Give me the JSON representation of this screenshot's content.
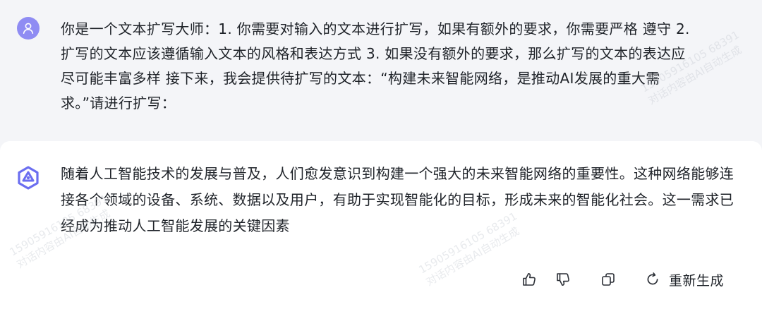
{
  "conversation": {
    "user_message": "你是一个文本扩写大师：1. 你需要对输入的文本进行扩写，如果有额外的要求，你需要严格 遵守 2. 扩写的文本应该遵循输入文本的风格和表达方式 3. 如果没有额外的要求，那么扩写的文本的表达应尽可能丰富多样 接下来，我会提供待扩写的文本：“构建未来智能网络，是推动AI发展的重大需求。”请进行扩写：",
    "assistant_message": "随着人工智能技术的发展与普及，人们愈发意识到构建一个强大的未来智能网络的重要性。这种网络能够连接各个领域的设备、系统、数据以及用户，有助于实现智能化的目标，形成未来的智能化社会。这一需求已经成为推动人工智能发展的关键因素"
  },
  "actions": {
    "like_icon": "thumbs-up-icon",
    "dislike_icon": "thumbs-down-icon",
    "copy_icon": "copy-icon",
    "regenerate_icon": "refresh-icon",
    "regenerate_label": "重新生成"
  },
  "watermark": {
    "id_text": "15905916105 68391",
    "caption": "对话内容由AI自动生成"
  },
  "colors": {
    "background": "#f4f5f8",
    "card": "#ffffff",
    "user_avatar": "#8f8cf3",
    "bot_logo": "#6b6ef0",
    "text": "#1f2329"
  }
}
